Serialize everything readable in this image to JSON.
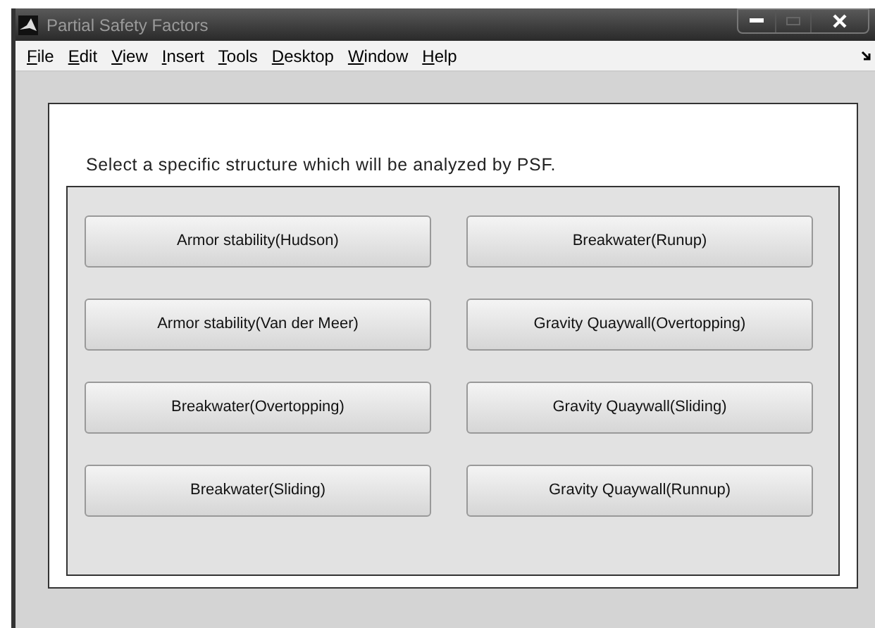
{
  "window": {
    "title": "Partial Safety Factors"
  },
  "menu": [
    "File",
    "Edit",
    "View",
    "Insert",
    "Tools",
    "Desktop",
    "Window",
    "Help"
  ],
  "panel": {
    "label": "Select a specific structure which will be analyzed by PSF.",
    "buttons": [
      [
        "Armor stability(Hudson)",
        "Breakwater(Runup)"
      ],
      [
        "Armor stability(Van der Meer)",
        "Gravity Quaywall(Overtopping)"
      ],
      [
        "Breakwater(Overtopping)",
        "Gravity Quaywall(Sliding)"
      ],
      [
        "Breakwater(Sliding)",
        "Gravity Quaywall(Runnup)"
      ]
    ]
  }
}
